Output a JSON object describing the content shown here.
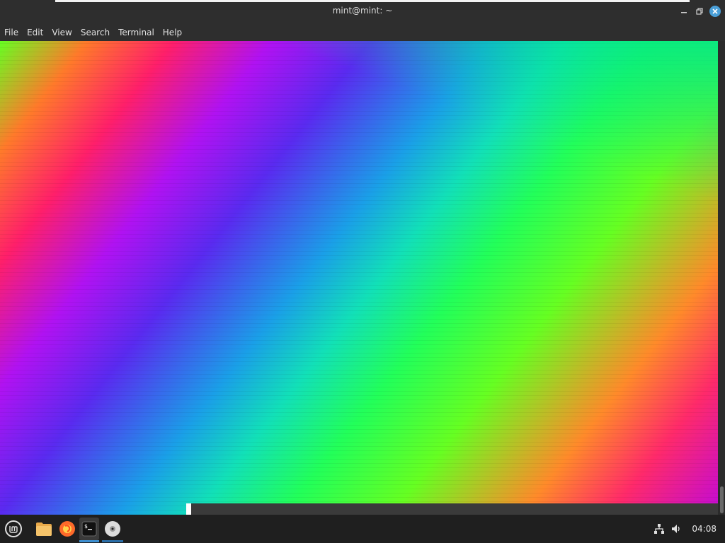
{
  "window": {
    "title": "mint@mint: ~",
    "buttons": [
      "minimize",
      "maximize",
      "close"
    ]
  },
  "menubar": {
    "items": [
      "File",
      "Edit",
      "View",
      "Search",
      "Terminal",
      "Help"
    ]
  },
  "terminal": {
    "content": "rainbow gradient fill",
    "colors": [
      "#66ff22",
      "#ff7a2a",
      "#ff1f6a",
      "#b012f2",
      "#5a2af0",
      "#1a9fe8",
      "#12e0b8",
      "#22ff5a",
      "#c20ad8"
    ]
  },
  "taskbar": {
    "launchers": [
      {
        "name": "menu",
        "icon": "linux-mint-icon"
      },
      {
        "name": "files",
        "icon": "folder-icon"
      },
      {
        "name": "firefox",
        "icon": "firefox-icon"
      },
      {
        "name": "terminal",
        "icon": "terminal-icon",
        "active": true
      },
      {
        "name": "disc",
        "icon": "disc-icon"
      }
    ],
    "tray": {
      "network_icon": "network-icon",
      "volume_icon": "volume-icon",
      "clock": "04:08"
    },
    "accent": "#3d8fd1"
  }
}
